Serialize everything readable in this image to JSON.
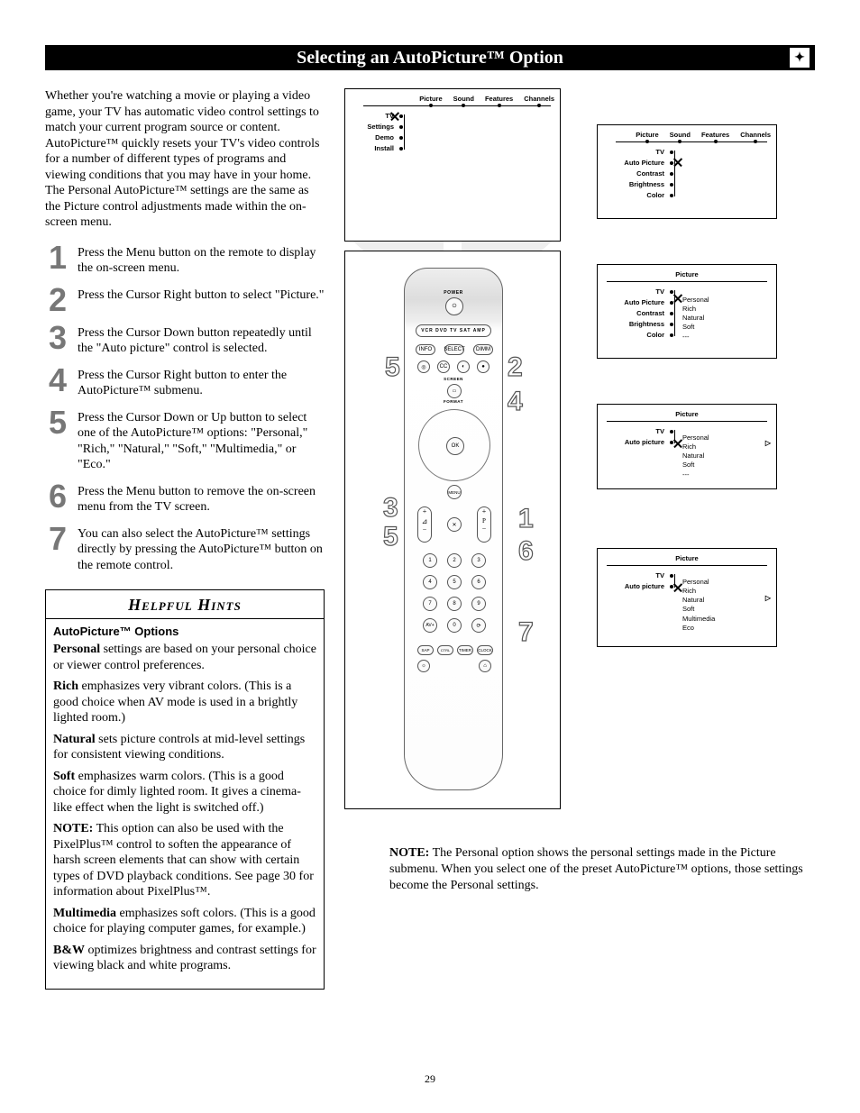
{
  "title": "Selecting an AutoPicture™ Option",
  "intro": "Whether you're watching a movie or playing a video game, your TV has automatic video control settings to match your current program source or content. AutoPicture™ quickly resets your TV's video controls for a number of different types of programs and viewing conditions that you may have in your home.  The Personal AutoPicture™ settings are the same as the Picture control adjustments made within the on-screen menu.",
  "steps": [
    {
      "n": "1",
      "t": "Press the Menu button on the remote to display the on-screen menu."
    },
    {
      "n": "2",
      "t": "Press the Cursor Right button to select \"Picture.\""
    },
    {
      "n": "3",
      "t": "Press the Cursor Down button repeatedly until the \"Auto picture\" control is selected."
    },
    {
      "n": "4",
      "t": "Press the Cursor Right button to enter the AutoPicture™ submenu."
    },
    {
      "n": "5",
      "t": "Press the Cursor Down or Up button to select one of the AutoPicture™ options: \"Personal,\" \"Rich,\" \"Natural,\" \"Soft,\" \"Multimedia,\" or \"Eco.\""
    },
    {
      "n": "6",
      "t": "Press the Menu button to remove the on-screen menu from the TV screen."
    },
    {
      "n": "7",
      "t": "You can also select the AutoPicture™ settings directly by pressing the AutoPicture™ button on the remote control."
    }
  ],
  "hints": {
    "title": "Helpful Hints",
    "subtitle": "AutoPicture™ Options",
    "items": [
      {
        "lead": "Personal",
        "rest": " settings are based on your personal choice or viewer control preferences."
      },
      {
        "lead": "Rich",
        "rest": " emphasizes very vibrant colors. (This is a good choice when AV mode is used in a brightly lighted room.)"
      },
      {
        "lead": "Natural",
        "rest": " sets picture controls at mid-level settings for consistent viewing conditions."
      },
      {
        "lead": "Soft",
        "rest": " emphasizes warm colors. (This is a good choice for dimly lighted room. It gives a cinema-like effect when the light is switched off.)"
      },
      {
        "lead": "NOTE:",
        "rest": " This option can also be used with the PixelPlus™ control to soften the appearance of harsh screen elements that can show with certain types of DVD playback conditions. See page 30 for information about PixelPlus™."
      },
      {
        "lead": "Multimedia",
        "rest": " emphasizes soft colors. (This is a good choice for playing computer games, for example.)"
      },
      {
        "lead": "B&W",
        "rest": " optimizes  brightness and contrast settings for viewing black and white programs."
      }
    ]
  },
  "menu_labels": {
    "top_tabs": [
      "Picture",
      "Sound",
      "Features",
      "Channels"
    ],
    "tv": "TV",
    "left_items_1": [
      "Settings",
      "Demo",
      "Install"
    ],
    "left_items_2": [
      "Auto Picture",
      "Contrast",
      "Brightness",
      "Color"
    ],
    "left_items_3": [
      "Auto Picture",
      "Contrast",
      "Brightness",
      "Color"
    ],
    "left_items_4": [
      "Auto picture"
    ],
    "left_items_5": [
      "Auto picture"
    ],
    "picture": "Picture",
    "options_a": [
      "Personal",
      "Rich",
      "Natural",
      "Soft",
      "---"
    ],
    "options_b": [
      "Personal",
      "Rich",
      "Natural",
      "Soft",
      "---"
    ],
    "options_c": [
      "Personal",
      "Rich",
      "Natural",
      "Soft",
      "Multimedia",
      "Eco"
    ]
  },
  "remote": {
    "power": "POWER",
    "modes": "VCR  DVD   TV  SAT AMP",
    "info": "INFO",
    "select": "SELECT",
    "dimm": "DIMM",
    "ok": "OK",
    "menu": "MENU",
    "cc": "CC",
    "screen": "SCREEN",
    "format": "FORMAT",
    "mute_sym": "🔇",
    "p": "P",
    "av": "AV+"
  },
  "right_note_lead": "NOTE:",
  "right_note": " The Personal option shows the personal settings made in the Picture submenu. When you select one of the preset AutoPicture™ options, those settings become the Personal settings.",
  "page_number": "29",
  "callouts": {
    "c1": "1",
    "c2": "2",
    "c3": "3",
    "c4": "4",
    "c5l": "5",
    "c5u": "5",
    "c6": "6",
    "c7": "7"
  }
}
